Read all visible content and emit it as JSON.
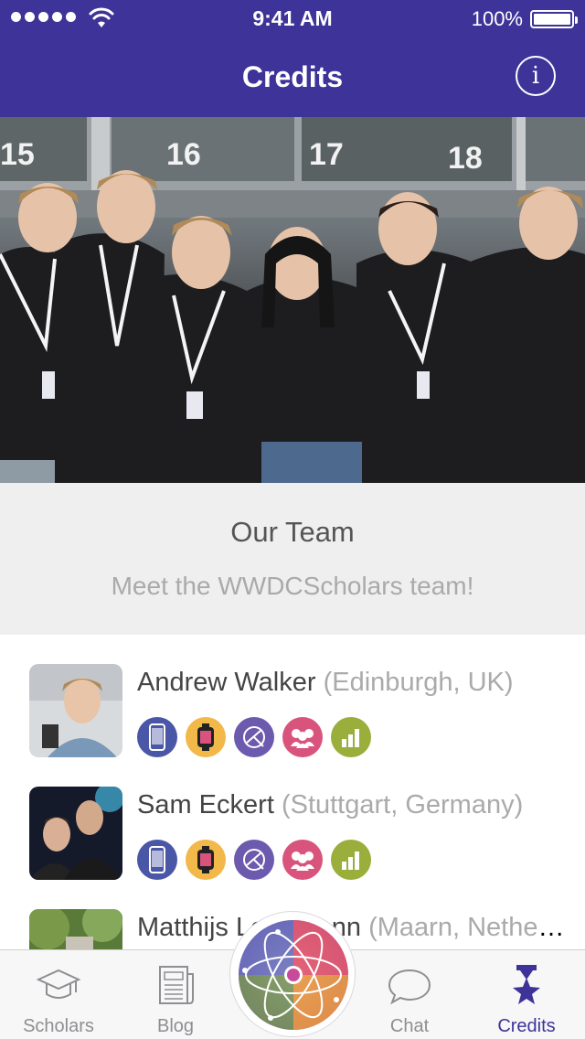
{
  "status_bar": {
    "time": "9:41 AM",
    "battery": "100%"
  },
  "nav": {
    "title": "Credits",
    "info_glyph": "i"
  },
  "team": {
    "title": "Our Team",
    "subtitle": "Meet the WWDCScholars team!"
  },
  "hero": {
    "door_numbers": [
      "15",
      "16",
      "17",
      "18"
    ]
  },
  "members": [
    {
      "name": "Andrew Walker",
      "location": "(Edinburgh, UK)"
    },
    {
      "name": "Sam Eckert",
      "location": "(Stuttgart, Germany)"
    },
    {
      "name": "Matthijs Logemann",
      "location": "(Maarn, Netherlands)"
    }
  ],
  "badge_icons": [
    "iphone-icon",
    "apple-watch-icon",
    "design-icon",
    "team-icon",
    "stats-icon"
  ],
  "badge_colors": [
    "#4a56a6",
    "#f2b84a",
    "#6b5aae",
    "#d9547c",
    "#9aae3c"
  ],
  "tabs": [
    {
      "label": "Scholars",
      "icon": "graduation-cap-icon"
    },
    {
      "label": "Blog",
      "icon": "newspaper-icon"
    },
    {
      "label": "Chat",
      "icon": "chat-bubble-icon"
    },
    {
      "label": "Credits",
      "icon": "star-trophy-icon"
    }
  ],
  "colors": {
    "brand": "#3d3398",
    "tab_inactive": "#8e8e93"
  }
}
